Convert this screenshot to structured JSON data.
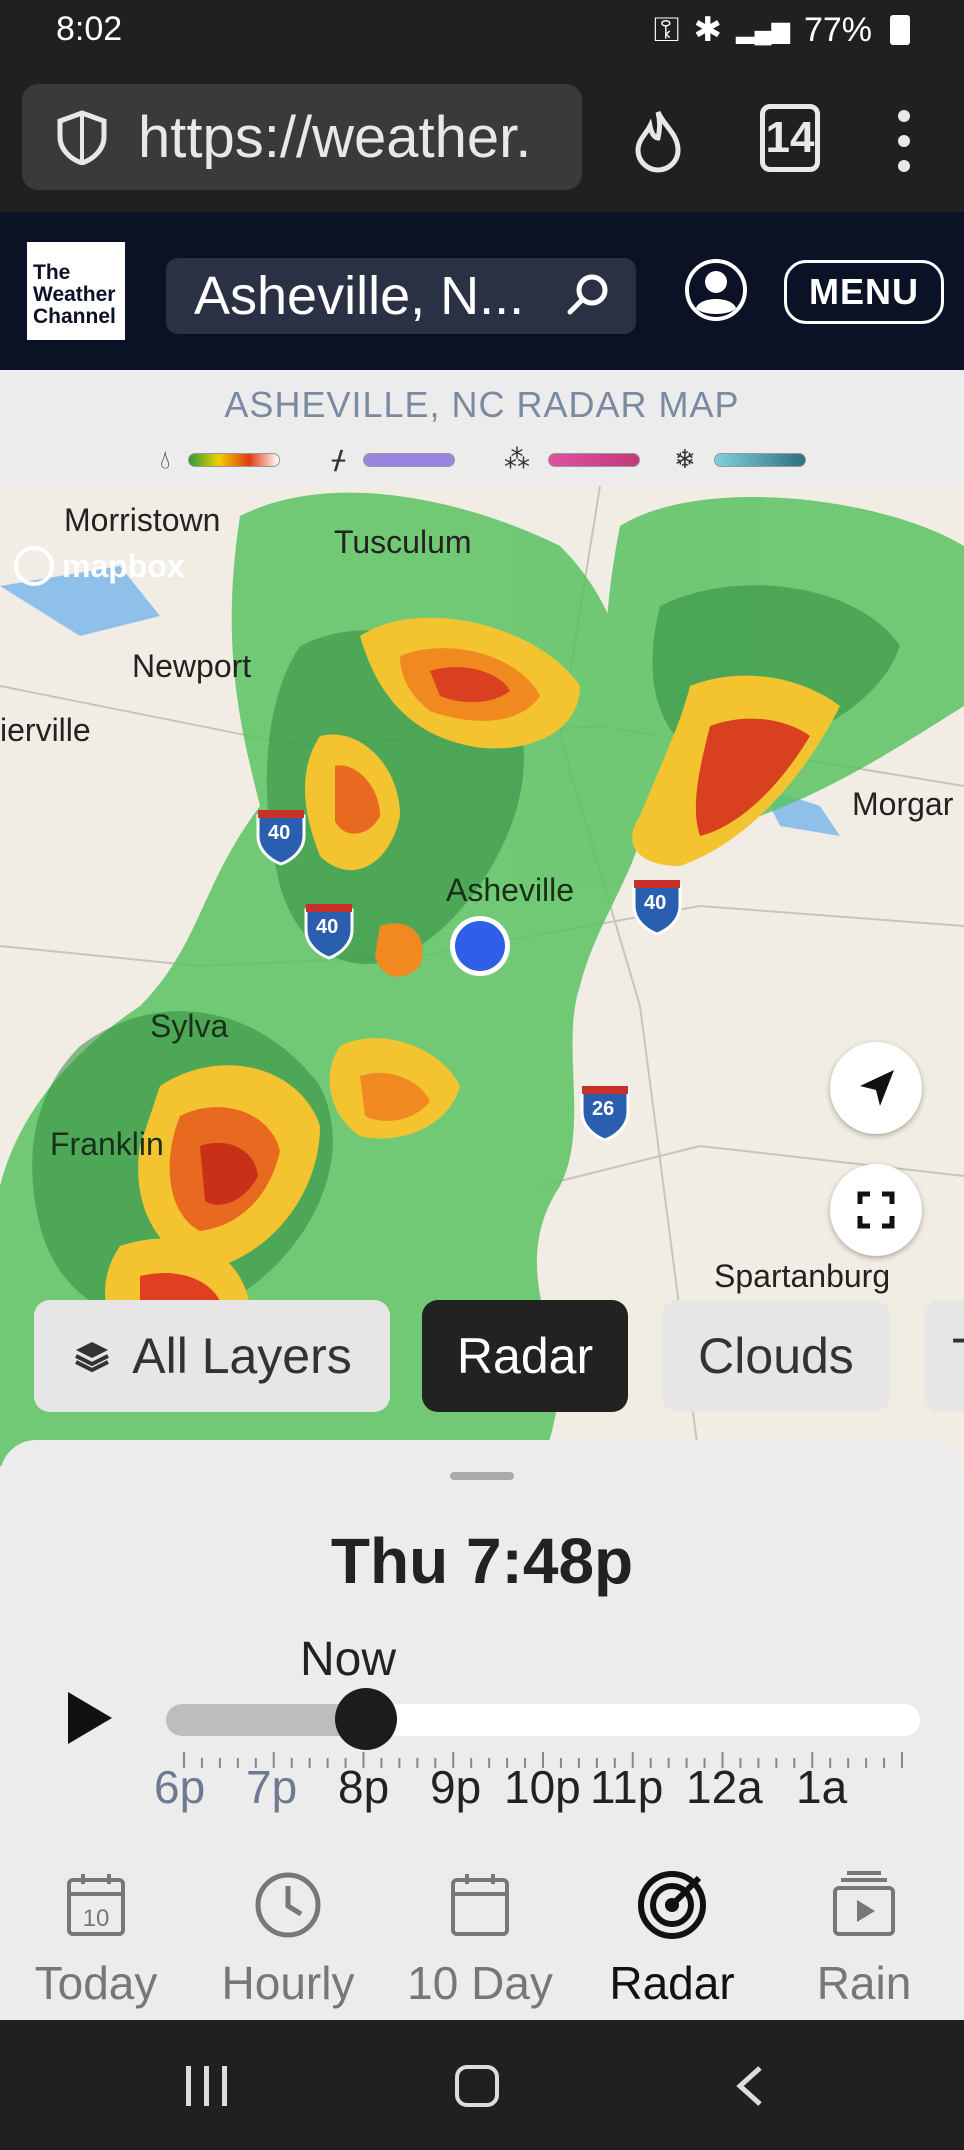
{
  "status_bar": {
    "time": "8:02",
    "battery": "77%"
  },
  "browser": {
    "url": "https://weather.",
    "tab_count": "14"
  },
  "header": {
    "logo_lines": [
      "The",
      "Weather",
      "Channel"
    ],
    "search_value": "Asheville, N...",
    "menu_label": "MENU"
  },
  "radar": {
    "title": "ASHEVILLE, NC RADAR MAP"
  },
  "legend": [
    {
      "icon": "rain-drop-icon",
      "colors": [
        "#2e9a3a",
        "#f0d000",
        "#e03a10",
        "#ffffff"
      ]
    },
    {
      "icon": "ice-icon",
      "colors": [
        "#9a86e0",
        "#7f6fd0"
      ]
    },
    {
      "icon": "mix-icon",
      "colors": [
        "#e050a0",
        "#c03a7a"
      ]
    },
    {
      "icon": "snow-icon",
      "colors": [
        "#7fd0e0",
        "#2f6f80"
      ]
    }
  ],
  "map": {
    "attribution": "mapbox",
    "cities": [
      "Morristown",
      "Tusculum",
      "Newport",
      "ierville",
      "Morgar",
      "Asheville",
      "Sylva",
      "Franklin",
      "Spartanburg",
      "ille"
    ],
    "interstates": [
      "40",
      "40",
      "40",
      "26"
    ]
  },
  "layers": [
    {
      "label": "All Layers",
      "active": false
    },
    {
      "label": "Radar",
      "active": true
    },
    {
      "label": "Clouds",
      "active": false
    },
    {
      "label": "T",
      "active": false
    }
  ],
  "timeline": {
    "current_time": "Thu 7:48p",
    "now_label": "Now",
    "progress": 0.265,
    "hours": [
      "6p",
      "7p",
      "8p",
      "9p",
      "10p",
      "11p",
      "12a",
      "1a"
    ]
  },
  "bottom_nav": [
    {
      "label": "Today",
      "icon": "calendar-today-icon",
      "badge": "10"
    },
    {
      "label": "Hourly",
      "icon": "clock-icon"
    },
    {
      "label": "10 Day",
      "icon": "calendar-icon"
    },
    {
      "label": "Radar",
      "icon": "radar-icon",
      "active": true
    },
    {
      "label": "Rain",
      "icon": "video-icon"
    }
  ]
}
